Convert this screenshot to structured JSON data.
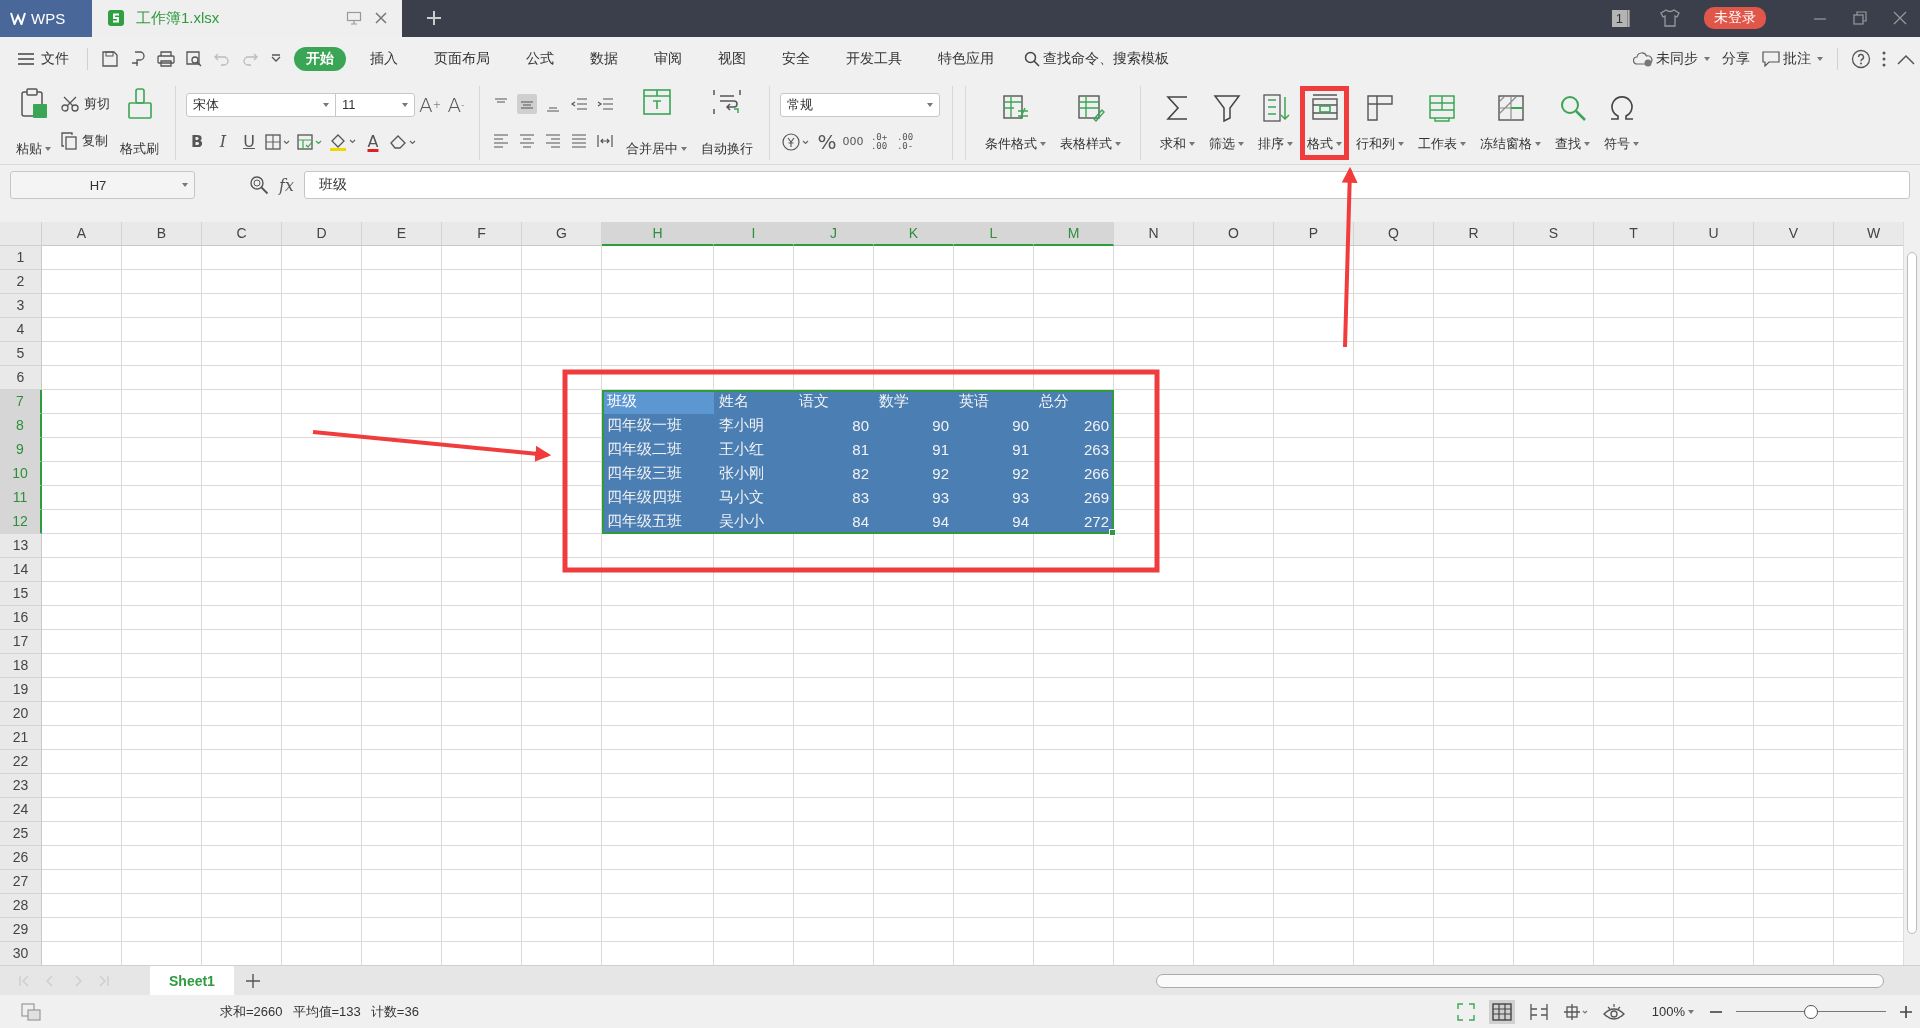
{
  "title_bar": {
    "app": "WPS",
    "document": "工作簿1.xlsx",
    "page_count": "1",
    "login": "未登录"
  },
  "menu_bar": {
    "file": "文件",
    "tabs": [
      {
        "label": "开始",
        "selected": true
      },
      {
        "label": "插入",
        "selected": false
      },
      {
        "label": "页面布局",
        "selected": false
      },
      {
        "label": "公式",
        "selected": false
      },
      {
        "label": "数据",
        "selected": false
      },
      {
        "label": "审阅",
        "selected": false
      },
      {
        "label": "视图",
        "selected": false
      },
      {
        "label": "安全",
        "selected": false
      },
      {
        "label": "开发工具",
        "selected": false
      },
      {
        "label": "特色应用",
        "selected": false
      }
    ],
    "search": "查找命令、搜索模板",
    "sync": "未同步",
    "share": "分享",
    "comment": "批注"
  },
  "ribbon": {
    "paste": "粘贴",
    "cut": "剪切",
    "copy": "复制",
    "format_painter": "格式刷",
    "font": "宋体",
    "font_size": "11",
    "grow_font": [
      "A",
      "+"
    ],
    "shrink_font": [
      "A",
      "-"
    ],
    "styles": [
      "B",
      "I",
      "U"
    ],
    "font_color": "A",
    "merge_center": "合并居中",
    "wrap_text": "自动换行",
    "number_format": "常规",
    "percent": "%",
    "thousands": "000",
    "increase_decimal": [
      ".0+",
      ".00"
    ],
    "decrease_decimal": [
      ".00",
      ".0-"
    ],
    "tools": [
      {
        "label": "条件格式",
        "highlighted": false
      },
      {
        "label": "表格样式",
        "highlighted": false
      },
      {
        "label": "求和",
        "highlighted": false
      },
      {
        "label": "筛选",
        "highlighted": false
      },
      {
        "label": "排序",
        "highlighted": false
      },
      {
        "label": "格式",
        "highlighted": true
      },
      {
        "label": "行和列",
        "highlighted": false
      },
      {
        "label": "工作表",
        "highlighted": false
      },
      {
        "label": "冻结窗格",
        "highlighted": false
      },
      {
        "label": "查找",
        "highlighted": false
      },
      {
        "label": "符号",
        "highlighted": false
      }
    ]
  },
  "formula_bar": {
    "cell": "H7",
    "fx": "fx",
    "value": "班级"
  },
  "sheet": {
    "columns": [
      {
        "label": "A",
        "selected": false
      },
      {
        "label": "B",
        "selected": false
      },
      {
        "label": "C",
        "selected": false
      },
      {
        "label": "D",
        "selected": false
      },
      {
        "label": "E",
        "selected": false
      },
      {
        "label": "F",
        "selected": false
      },
      {
        "label": "G",
        "selected": false
      },
      {
        "label": "H",
        "selected": true
      },
      {
        "label": "I",
        "selected": true
      },
      {
        "label": "J",
        "selected": true
      },
      {
        "label": "K",
        "selected": true
      },
      {
        "label": "L",
        "selected": true
      },
      {
        "label": "M",
        "selected": true
      },
      {
        "label": "N",
        "selected": false
      },
      {
        "label": "O",
        "selected": false
      },
      {
        "label": "P",
        "selected": false
      },
      {
        "label": "Q",
        "selected": false
      },
      {
        "label": "R",
        "selected": false
      },
      {
        "label": "S",
        "selected": false
      },
      {
        "label": "T",
        "selected": false
      },
      {
        "label": "U",
        "selected": false
      },
      {
        "label": "V",
        "selected": false
      },
      {
        "label": "W",
        "selected": false
      }
    ],
    "rows": [
      {
        "label": "1",
        "selected": false
      },
      {
        "label": "2",
        "selected": false
      },
      {
        "label": "3",
        "selected": false
      },
      {
        "label": "4",
        "selected": false
      },
      {
        "label": "5",
        "selected": false
      },
      {
        "label": "6",
        "selected": false
      },
      {
        "label": "7",
        "selected": true
      },
      {
        "label": "8",
        "selected": true
      },
      {
        "label": "9",
        "selected": true
      },
      {
        "label": "10",
        "selected": true
      },
      {
        "label": "11",
        "selected": true
      },
      {
        "label": "12",
        "selected": true
      },
      {
        "label": "13",
        "selected": false
      },
      {
        "label": "14",
        "selected": false
      },
      {
        "label": "15",
        "selected": false
      },
      {
        "label": "16",
        "selected": false
      },
      {
        "label": "17",
        "selected": false
      },
      {
        "label": "18",
        "selected": false
      },
      {
        "label": "19",
        "selected": false
      },
      {
        "label": "20",
        "selected": false
      },
      {
        "label": "21",
        "selected": false
      },
      {
        "label": "22",
        "selected": false
      },
      {
        "label": "23",
        "selected": false
      },
      {
        "label": "24",
        "selected": false
      },
      {
        "label": "25",
        "selected": false
      },
      {
        "label": "26",
        "selected": false
      },
      {
        "label": "27",
        "selected": false
      },
      {
        "label": "28",
        "selected": false
      },
      {
        "label": "29",
        "selected": false
      },
      {
        "label": "30",
        "selected": false
      }
    ],
    "table": [
      [
        "班级",
        "姓名",
        "语文",
        "数学",
        "英语",
        "总分"
      ],
      [
        "四年级一班",
        "李小明",
        "80",
        "90",
        "90",
        "260"
      ],
      [
        "四年级二班",
        "王小红",
        "81",
        "91",
        "91",
        "263"
      ],
      [
        "四年级三班",
        "张小刚",
        "82",
        "92",
        "92",
        "266"
      ],
      [
        "四年级四班",
        "马小文",
        "83",
        "93",
        "93",
        "269"
      ],
      [
        "四年级五班",
        "吴小小",
        "84",
        "94",
        "94",
        "272"
      ]
    ]
  },
  "sheet_tabs": [
    {
      "label": "Sheet1",
      "selected": true
    }
  ],
  "status_bar": {
    "stats": [
      "求和=2660",
      "平均值=133",
      "计数=36"
    ],
    "zoom": "100%",
    "zoom_slider": {
      "level": 0.5
    }
  }
}
